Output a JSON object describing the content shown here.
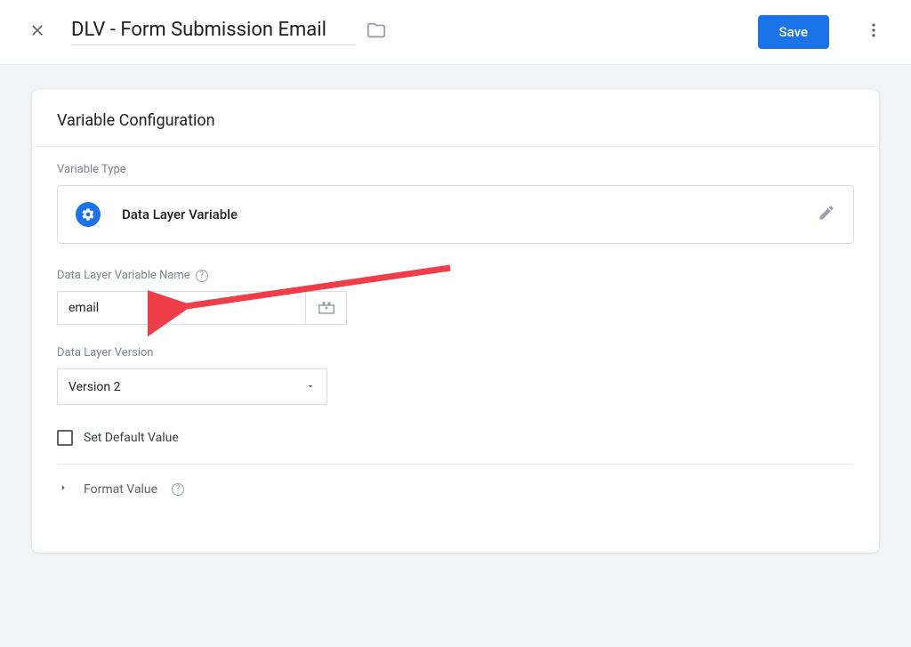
{
  "header": {
    "title": "DLV - Form Submission Email",
    "save_label": "Save"
  },
  "card": {
    "title": "Variable Configuration",
    "variable_type_label": "Variable Type",
    "variable_type_name": "Data Layer Variable",
    "dlv_name_label": "Data Layer Variable Name",
    "dlv_name_value": "email",
    "dlv_version_label": "Data Layer Version",
    "dlv_version_value": "Version 2",
    "set_default_label": "Set Default Value",
    "format_value_label": "Format Value"
  }
}
